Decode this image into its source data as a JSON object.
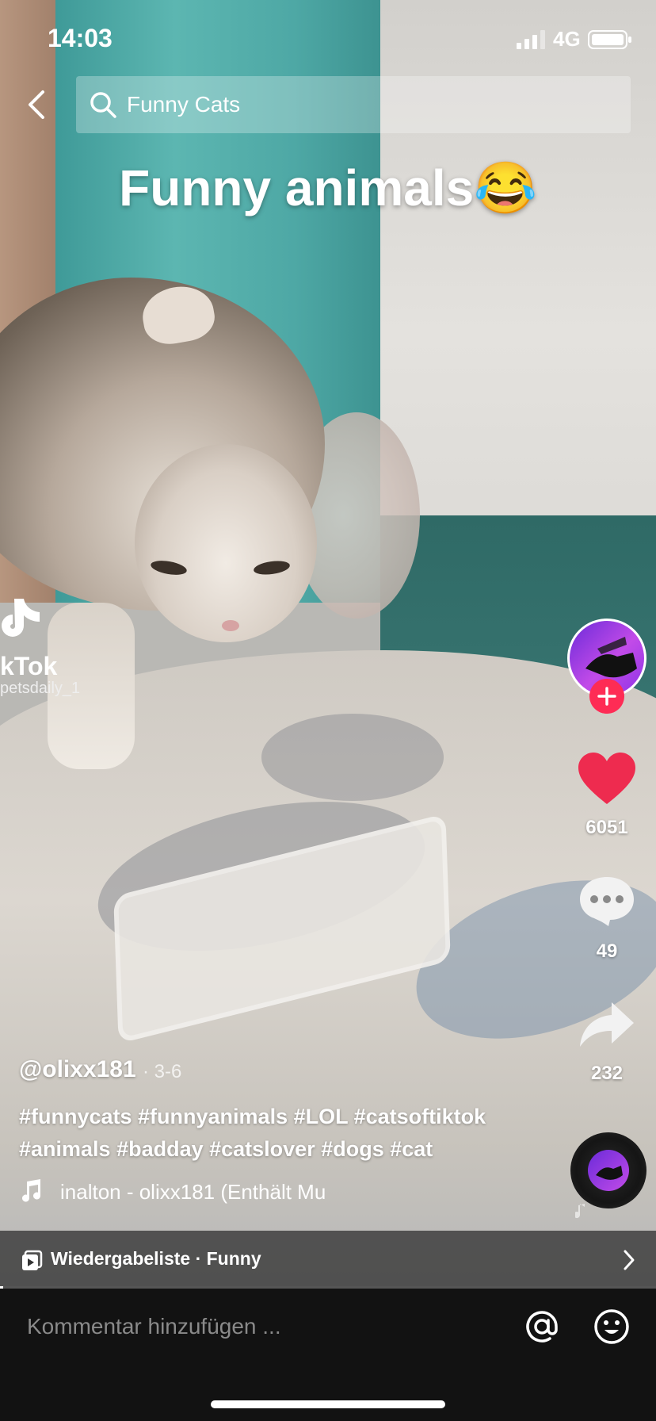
{
  "status_bar": {
    "time": "14:03",
    "network": "4G"
  },
  "search": {
    "query": "Funny Cats"
  },
  "video": {
    "caption": "Funny animals😂",
    "watermark_brand": "kTok",
    "watermark_handle": "petsdaily_1"
  },
  "actions": {
    "likes": "6051",
    "comments": "49",
    "shares": "232"
  },
  "post": {
    "username": "@olixx181",
    "date": "· 3-6",
    "hashtags": "#funnycats #funnyanimals #LOL #catsoftiktok #animals #badday #catslover #dogs #cat",
    "sound": "inalton - olixx181 (Enthält Mu"
  },
  "playlist": {
    "label": "Wiedergabeliste · Funny"
  },
  "comment_bar": {
    "placeholder": "Kommentar hinzufügen ..."
  },
  "colors": {
    "accent": "#fe2c55",
    "like": "#ee2b4f"
  }
}
